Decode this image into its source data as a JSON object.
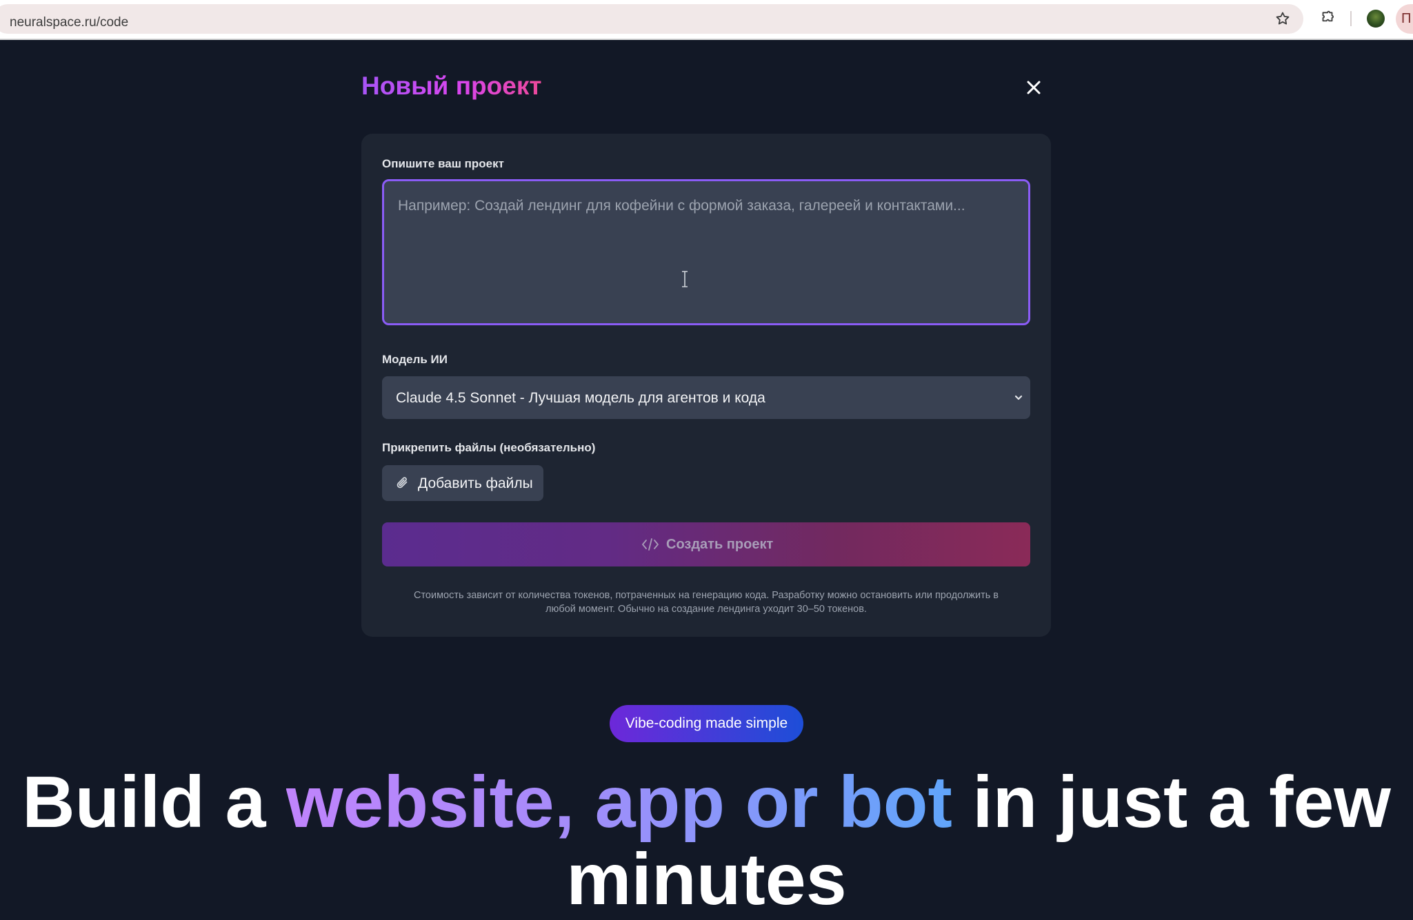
{
  "browser": {
    "url": "neuralspace.ru/code",
    "profile_initial": "П"
  },
  "modal": {
    "title": "Новый проект",
    "description_label": "Опишите ваш проект",
    "description_placeholder": "Например: Создай лендинг для кофейни с формой заказа, галереей и контактами...",
    "description_value": "",
    "model_label": "Модель ИИ",
    "model_selected": "Claude 4.5 Sonnet - Лучшая модель для агентов и кода",
    "attach_label": "Прикрепить файлы (необязательно)",
    "add_files_label": "Добавить файлы",
    "create_label": "Создать проект",
    "note_line1": "Стоимость зависит от количества токенов, потраченных на генерацию кода. Разработку можно остановить или продолжить в",
    "note_line2": "любой момент. Обычно на создание лендинга уходит 30–50 токенов."
  },
  "hero": {
    "badge": "Vibe-coding made simple",
    "headline_start": "Build a ",
    "headline_highlight": "website, app or bot",
    "headline_end": " in just a few minutes"
  },
  "colors": {
    "background": "#121826",
    "card": "#1e2532",
    "accent": "#8b5cf6",
    "title_gradient_start": "#a855f7",
    "title_gradient_end": "#ec4899"
  }
}
